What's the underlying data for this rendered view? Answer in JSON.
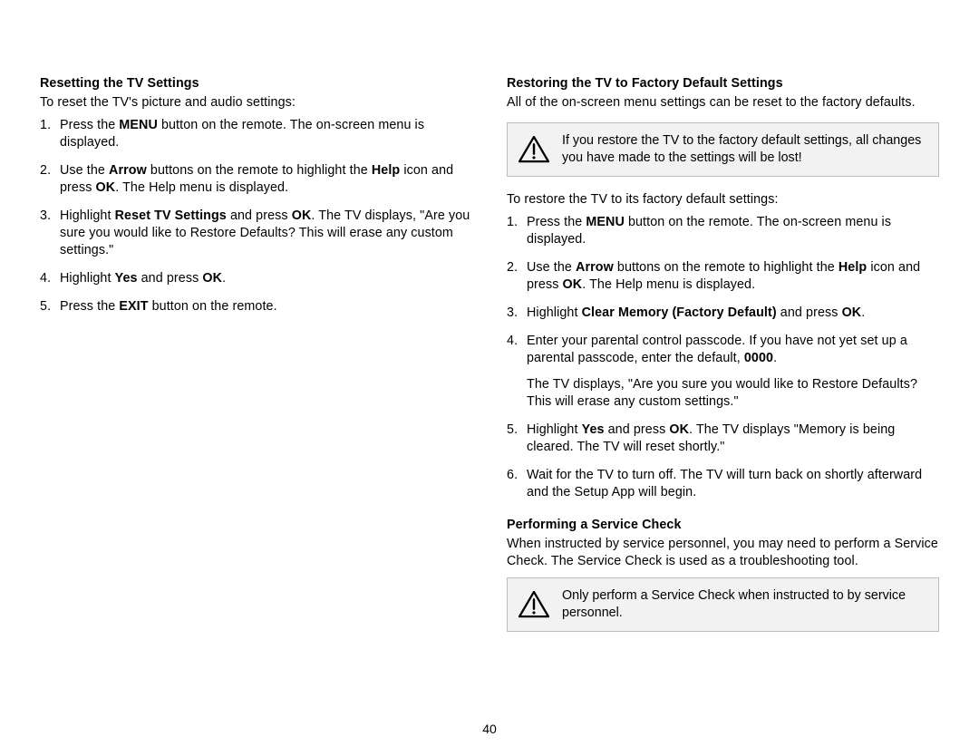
{
  "page_number": "40",
  "left": {
    "heading": "Resetting the TV Settings",
    "intro": "To reset the TV's picture and audio settings:",
    "steps": {
      "s1a": "Press the ",
      "s1b": "MENU",
      "s1c": " button on the remote. The on-screen menu is displayed.",
      "s2a": "Use the ",
      "s2b": "Arrow",
      "s2c": " buttons on the remote to highlight the ",
      "s2d": "Help",
      "s2e": " icon and press ",
      "s2f": "OK",
      "s2g": ". The Help menu is displayed.",
      "s3a": "Highlight ",
      "s3b": "Reset TV Settings",
      "s3c": " and press ",
      "s3d": "OK",
      "s3e": ". The TV displays, \"Are you sure you would like to Restore Defaults? This will erase any custom settings.\"",
      "s4a": "Highlight ",
      "s4b": "Yes",
      "s4c": " and press ",
      "s4d": "OK",
      "s4e": ".",
      "s5a": "Press the ",
      "s5b": "EXIT",
      "s5c": " button on the remote."
    }
  },
  "right": {
    "heading": "Restoring the TV to Factory Default Settings",
    "intro": "All of the on-screen menu settings can be reset to the factory defaults.",
    "callout1": "If you restore the TV to the factory default settings, all changes you have made to the settings will be lost!",
    "intro2": "To restore the TV to its factory default settings:",
    "steps": {
      "s1a": "Press the ",
      "s1b": "MENU",
      "s1c": " button on the remote. The on-screen menu is displayed.",
      "s2a": "Use the ",
      "s2b": "Arrow",
      "s2c": " buttons on the remote to highlight the ",
      "s2d": "Help",
      "s2e": " icon and press ",
      "s2f": "OK",
      "s2g": ". The Help menu is displayed.",
      "s3a": "Highlight ",
      "s3b": "Clear Memory (Factory Default)",
      "s3c": " and press ",
      "s3d": "OK",
      "s3e": ".",
      "s4a": "Enter your parental control passcode. If you have not yet set up a parental passcode, enter the default, ",
      "s4b": "0000",
      "s4c": ".",
      "s4sub": "The TV displays, \"Are you sure you would like to Restore Defaults? This will erase any custom settings.\"",
      "s5a": "Highlight ",
      "s5b": "Yes",
      "s5c": " and press ",
      "s5d": "OK",
      "s5e": ". The TV displays \"Memory is being cleared. The TV will reset shortly.\"",
      "s6": "Wait for the TV to turn off. The TV will turn back on shortly afterward and the Setup App will begin."
    },
    "heading2": "Performing a Service Check",
    "p2": "When instructed by service personnel, you may need to perform a Service Check. The Service Check is used as a troubleshooting tool.",
    "callout2": "Only perform a Service Check when instructed to by service personnel."
  }
}
